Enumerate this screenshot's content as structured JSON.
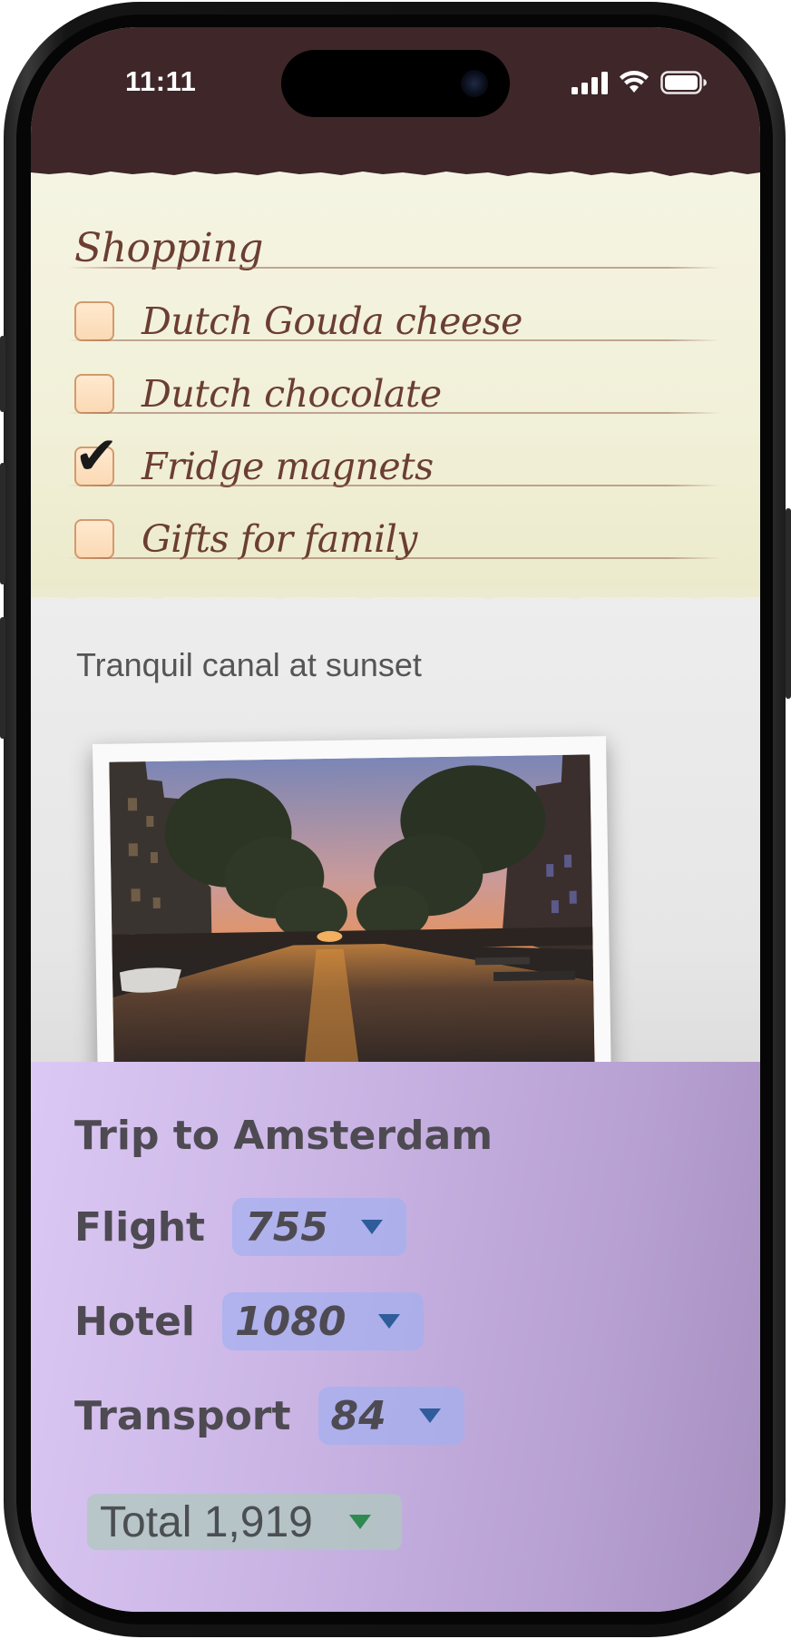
{
  "status_bar": {
    "time": "11:11",
    "icons": [
      "signal-icon",
      "wifi-icon",
      "battery-icon"
    ]
  },
  "shopping": {
    "title": "Shopping",
    "items": [
      {
        "label": "Dutch Gouda cheese",
        "checked": false
      },
      {
        "label": "Dutch chocolate",
        "checked": false
      },
      {
        "label": "Fridge magnets",
        "checked": true
      },
      {
        "label": "Gifts for family",
        "checked": false
      }
    ],
    "check_mark": "✔"
  },
  "photo": {
    "caption": "Tranquil canal at sunset"
  },
  "trip": {
    "title": "Trip to Amsterdam",
    "rows": [
      {
        "label": "Flight",
        "value": "755"
      },
      {
        "label": "Hotel",
        "value": "1080"
      },
      {
        "label": "Transport",
        "value": "84"
      }
    ],
    "total": "Total 1,919"
  },
  "colors": {
    "status_bar": "#3e2629",
    "note_ink": "#6b3e32",
    "pill_bg": "#a0aff0",
    "dropdown_blue": "#2f5c9a",
    "dropdown_green": "#2e8a50"
  }
}
